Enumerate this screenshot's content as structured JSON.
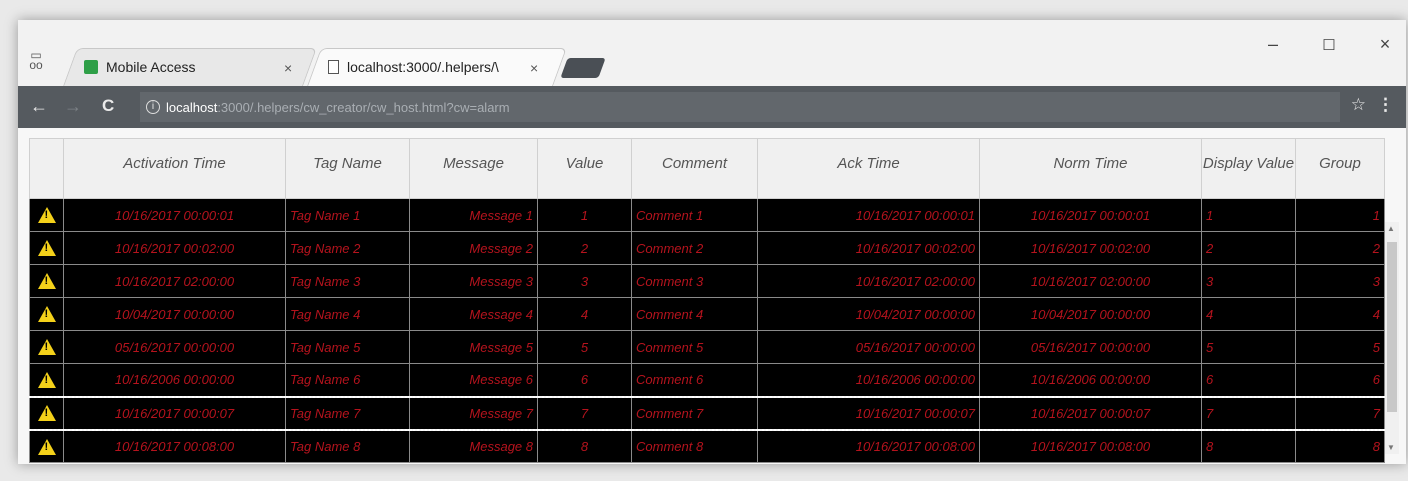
{
  "browser": {
    "tabs": [
      {
        "title": "Mobile Access",
        "close": "×"
      },
      {
        "title": "localhost:3000/.helpers/\\",
        "close": "×"
      }
    ],
    "window": {
      "minimize": "–",
      "maximize": "☐",
      "close": "×"
    },
    "nav": {
      "back": "←",
      "forward": "→",
      "reload": "C"
    },
    "address": {
      "host": "localhost",
      "rest": ":3000/.helpers/cw_creator/cw_host.html?cw=alarm"
    },
    "star": "☆",
    "menu": "⋮"
  },
  "table": {
    "columns": [
      "",
      "Activation Time",
      "Tag Name",
      "Message",
      "Value",
      "Comment",
      "Ack Time",
      "Norm Time",
      "Display Value",
      "Group"
    ],
    "rows": [
      {
        "activation": "10/16/2017 00:00:01",
        "tag": "Tag Name 1",
        "message": "Message 1",
        "value": "1",
        "comment": "Comment 1",
        "ack": "10/16/2017 00:00:01",
        "norm": "10/16/2017 00:00:01",
        "display": "1",
        "group": "1"
      },
      {
        "activation": "10/16/2017 00:02:00",
        "tag": "Tag Name 2",
        "message": "Message 2",
        "value": "2",
        "comment": "Comment 2",
        "ack": "10/16/2017 00:02:00",
        "norm": "10/16/2017 00:02:00",
        "display": "2",
        "group": "2"
      },
      {
        "activation": "10/16/2017 02:00:00",
        "tag": "Tag Name 3",
        "message": "Message 3",
        "value": "3",
        "comment": "Comment 3",
        "ack": "10/16/2017 02:00:00",
        "norm": "10/16/2017 02:00:00",
        "display": "3",
        "group": "3"
      },
      {
        "activation": "10/04/2017 00:00:00",
        "tag": "Tag Name 4",
        "message": "Message 4",
        "value": "4",
        "comment": "Comment 4",
        "ack": "10/04/2017 00:00:00",
        "norm": "10/04/2017 00:00:00",
        "display": "4",
        "group": "4"
      },
      {
        "activation": "05/16/2017 00:00:00",
        "tag": "Tag Name 5",
        "message": "Message 5",
        "value": "5",
        "comment": "Comment 5",
        "ack": "05/16/2017 00:00:00",
        "norm": "05/16/2017 00:00:00",
        "display": "5",
        "group": "5"
      },
      {
        "activation": "10/16/2006 00:00:00",
        "tag": "Tag Name 6",
        "message": "Message 6",
        "value": "6",
        "comment": "Comment 6",
        "ack": "10/16/2006 00:00:00",
        "norm": "10/16/2006 00:00:00",
        "display": "6",
        "group": "6"
      },
      {
        "activation": "10/16/2017 00:00:07",
        "tag": "Tag Name 7",
        "message": "Message 7",
        "value": "7",
        "comment": "Comment 7",
        "ack": "10/16/2017 00:00:07",
        "norm": "10/16/2017 00:00:07",
        "display": "7",
        "group": "7"
      },
      {
        "activation": "10/16/2017 00:08:00",
        "tag": "Tag Name 8",
        "message": "Message 8",
        "value": "8",
        "comment": "Comment 8",
        "ack": "10/16/2017 00:08:00",
        "norm": "10/16/2017 00:08:00",
        "display": "8",
        "group": "8"
      }
    ]
  },
  "colors": {
    "row_text": "#b5131d",
    "row_bg": "#000000",
    "toolbar": "#555a5f",
    "warning": "#f4d11a"
  }
}
